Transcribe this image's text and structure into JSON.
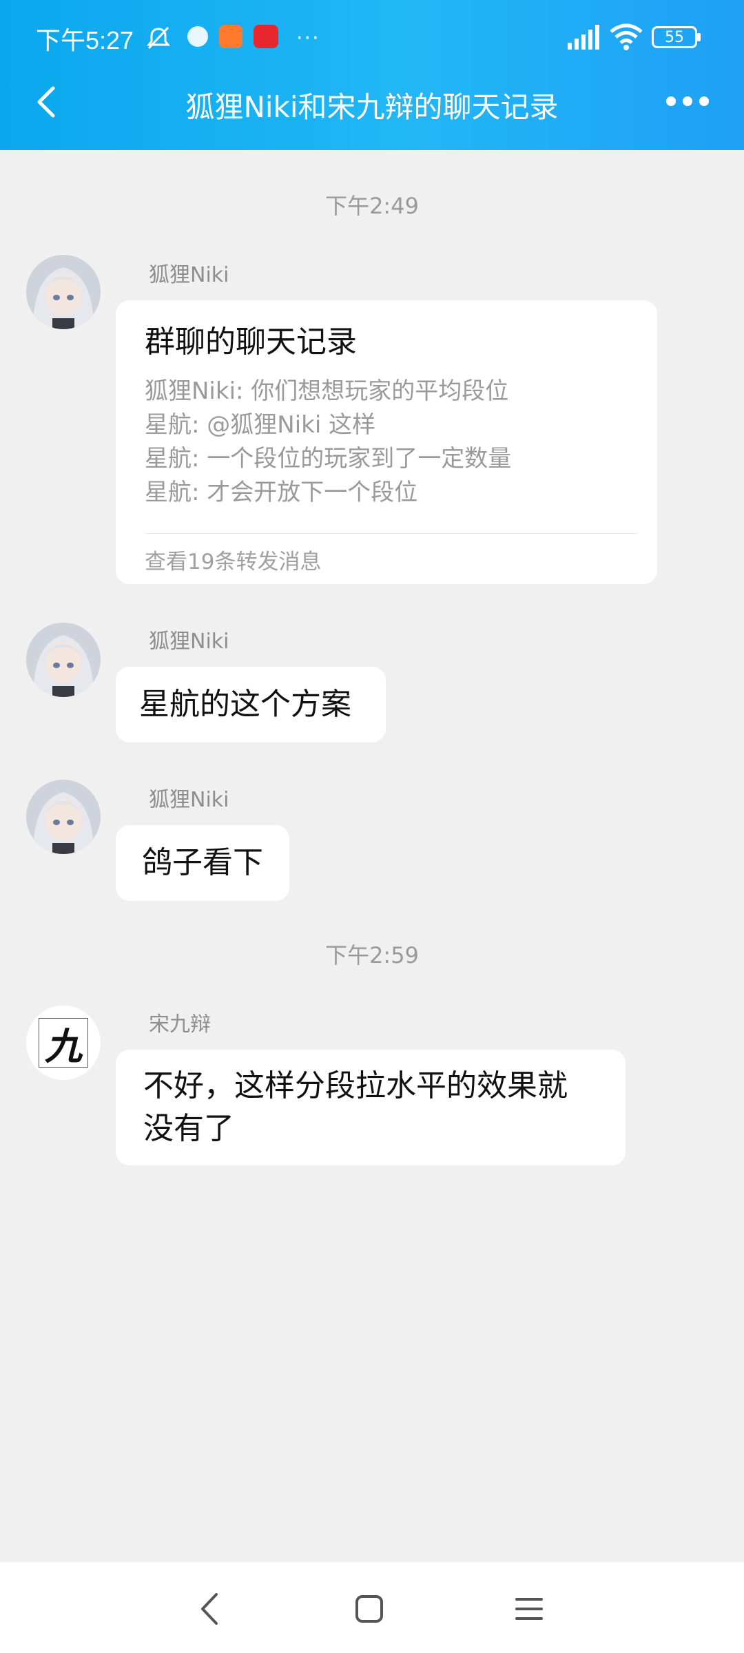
{
  "status_bar": {
    "time": "下午5:27",
    "more": "···",
    "battery": "55"
  },
  "header": {
    "title": "狐狸Niki和宋九辩的聊天记录"
  },
  "messages": [
    {
      "timestamp": "下午2:49"
    },
    {
      "sender": "狐狸Niki",
      "type": "forward",
      "card_title": "群聊的聊天记录",
      "lines": [
        "狐狸Niki:  你们想想玩家的平均段位",
        "星航:  @狐狸Niki 这样",
        "星航:  一个段位的玩家到了一定数量",
        "星航:  才会开放下一个段位"
      ],
      "footer": "查看19条转发消息"
    },
    {
      "sender": "狐狸Niki",
      "text": "星航的这个方案"
    },
    {
      "sender": "狐狸Niki",
      "text": "鸽子看下"
    },
    {
      "timestamp": "下午2:59"
    },
    {
      "sender": "宋九辩",
      "avatar_char": "九",
      "text_lines": [
        "不好，这样分段拉水平的效果就",
        "没有了"
      ]
    }
  ],
  "colors": {
    "header": "#1ea0f5",
    "background": "#f0f0f0",
    "bubble": "#ffffff"
  }
}
